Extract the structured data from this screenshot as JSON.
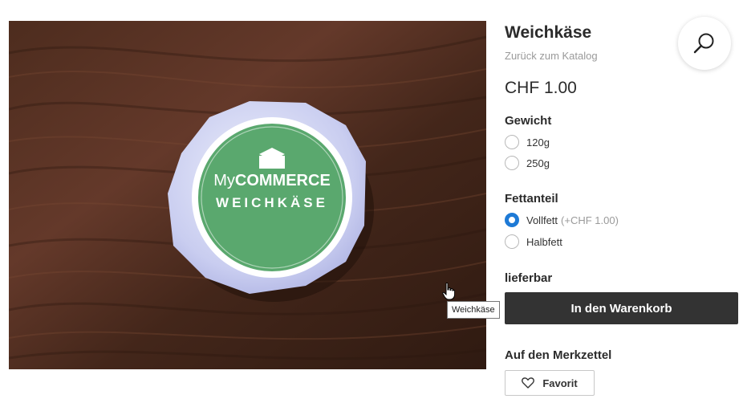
{
  "product": {
    "title": "Weichkäse",
    "back_link": "Zurück zum Katalog",
    "price": "CHF 1.00",
    "image_brand_prefix": "My",
    "image_brand": "COMMERCE",
    "image_label": "WEICHKÄSE"
  },
  "options": {
    "weight": {
      "label": "Gewicht",
      "choices": [
        {
          "label": "120g",
          "selected": false
        },
        {
          "label": "250g",
          "selected": false
        }
      ]
    },
    "fat": {
      "label": "Fettanteil",
      "choices": [
        {
          "label": "Vollfett",
          "surcharge": "(+CHF 1.00)",
          "selected": true
        },
        {
          "label": "Halbfett",
          "surcharge": "",
          "selected": false
        }
      ]
    }
  },
  "availability": "lieferbar",
  "cart_button": "In den Warenkorb",
  "wishlist": {
    "label": "Auf den Merkzettel",
    "button": "Favorit"
  },
  "tooltip": "Weichkäse",
  "icons": {
    "search": "search-icon",
    "favorite": "heart-icon",
    "cursor": "hand-pointer-icon"
  },
  "colors": {
    "accent": "#1e7ad6",
    "button_dark": "#333333",
    "label_green": "#5aa86e"
  }
}
